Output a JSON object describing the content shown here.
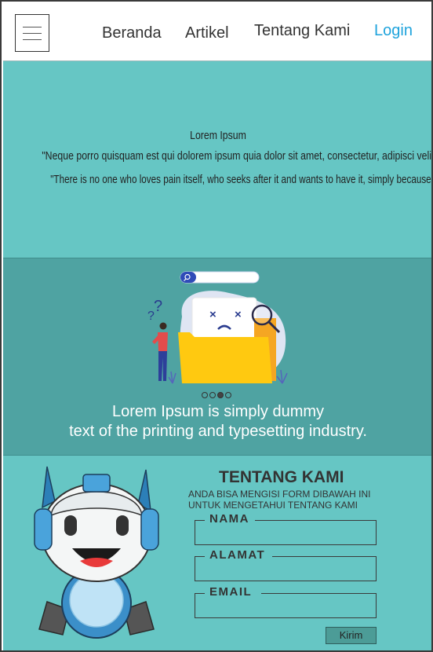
{
  "header": {
    "menu_icon": "hamburger-menu-icon",
    "nav": {
      "home": "Beranda",
      "articles": "Artikel",
      "about": "Tentang Kami",
      "login": "Login"
    },
    "login_color": "#1ea3dc"
  },
  "hero": {
    "background": "#66c6c4",
    "title": "Lorem Ipsum",
    "quote_1": "\"Neque porro quisquam est qui dolorem ipsum quia dolor sit amet, consectetur, adipisci velit...\"",
    "quote_2": "\"There is no one who loves pain itself, who seeks after it and wants to have it, simply because it is pain...\""
  },
  "slider": {
    "background": "#4fa3a2",
    "illustration": "not-found-folder-illustration",
    "dots_count": 4,
    "active_dot": 3,
    "text_line_1": "Lorem Ipsum is simply dummy",
    "text_line_2": "text of the printing and typesetting industry."
  },
  "about": {
    "background": "#66c6c4",
    "mascot": "robot-mascot",
    "title": "TENTANG KAMI",
    "desc_line_1": "ANDA BISA MENGISI FORM DIBAWAH INI",
    "desc_line_2": "UNTUK MENGETAHUI TENTANG KAMI",
    "form": {
      "name_label": "NAMA",
      "address_label": "ALAMAT",
      "email_label": "EMAIL",
      "submit_label": "Kirim"
    }
  }
}
